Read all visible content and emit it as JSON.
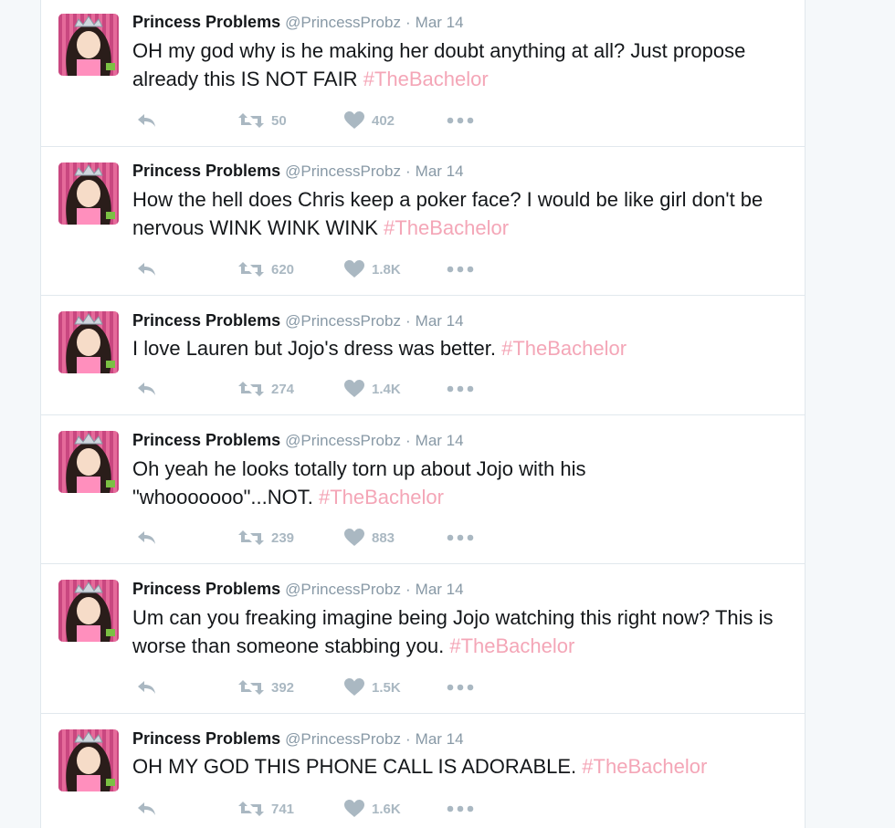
{
  "colors": {
    "hashtag": "#f4a6b7",
    "meta": "#8899a6",
    "icon": "#aab8c2"
  },
  "tweets": [
    {
      "name": "Princess Problems",
      "handle": "@PrincessProbz",
      "separator": "·",
      "date": "Mar 14",
      "text": "OH my god why is he making her doubt anything at all? Just propose already this IS NOT FAIR ",
      "hashtag": "#TheBachelor",
      "retweets": "50",
      "likes": "402"
    },
    {
      "name": "Princess Problems",
      "handle": "@PrincessProbz",
      "separator": "·",
      "date": "Mar 14",
      "text": "How the hell does Chris keep a poker face? I would be like girl don't be nervous WINK WINK WINK ",
      "hashtag": "#TheBachelor",
      "retweets": "620",
      "likes": "1.8K"
    },
    {
      "name": "Princess Problems",
      "handle": "@PrincessProbz",
      "separator": "·",
      "date": "Mar 14",
      "text": "I love Lauren but Jojo's dress was better. ",
      "hashtag": "#TheBachelor",
      "retweets": "274",
      "likes": "1.4K"
    },
    {
      "name": "Princess Problems",
      "handle": "@PrincessProbz",
      "separator": "·",
      "date": "Mar 14",
      "text": "Oh yeah he looks totally torn up about Jojo with his \"whooooooo\"...NOT. ",
      "hashtag": "#TheBachelor",
      "retweets": "239",
      "likes": "883"
    },
    {
      "name": "Princess Problems",
      "handle": "@PrincessProbz",
      "separator": "·",
      "date": "Mar 14",
      "text": "Um can you freaking imagine being Jojo watching this right now? This is worse than someone stabbing you. ",
      "hashtag": "#TheBachelor",
      "retweets": "392",
      "likes": "1.5K"
    },
    {
      "name": "Princess Problems",
      "handle": "@PrincessProbz",
      "separator": "·",
      "date": "Mar 14",
      "text": "OH MY GOD THIS PHONE CALL IS ADORABLE. ",
      "hashtag": "#TheBachelor",
      "retweets": "741",
      "likes": "1.6K"
    }
  ]
}
